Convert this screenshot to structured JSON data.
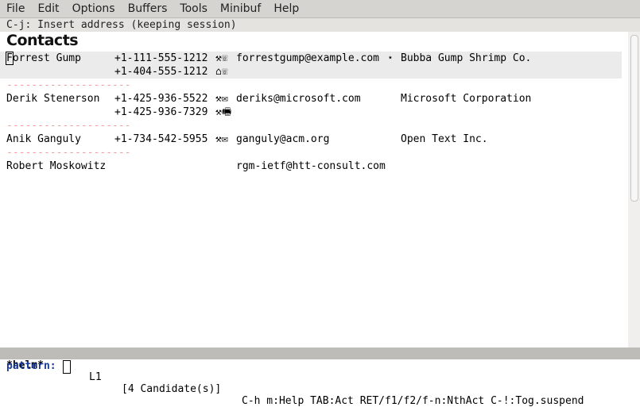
{
  "menu": [
    "File",
    "Edit",
    "Options",
    "Buffers",
    "Tools",
    "Minibuf",
    "Help"
  ],
  "helpline": "C-j: Insert address (keeping session)",
  "title": "Contacts",
  "contacts": [
    {
      "name": "Forrest Gump",
      "phones": [
        {
          "number": "+1-111-555-1212",
          "icons": "⚒☏"
        },
        {
          "number": "+1-404-555-1212",
          "icons": "⌂☏"
        }
      ],
      "email": "forrestgump@example.com",
      "star": "⋆",
      "org": "Bubba Gump Shrimp Co."
    },
    {
      "name": "Derik Stenerson",
      "phones": [
        {
          "number": "+1-425-936-5522",
          "icons": "⚒✉"
        },
        {
          "number": "+1-425-936-7329",
          "icons": "⚒🖷"
        }
      ],
      "email": "deriks@microsoft.com",
      "org": "Microsoft Corporation"
    },
    {
      "name": "Anik Ganguly",
      "phones": [
        {
          "number": "+1-734-542-5955",
          "icons": "⚒✉"
        }
      ],
      "email": "ganguly@acm.org",
      "org": "Open Text Inc."
    },
    {
      "name": "Robert Moskowitz",
      "email": "rgm-ietf@htt-consult.com"
    }
  ],
  "separator": "--------------------",
  "modeline": {
    "buffer": "*helm*",
    "line": "L1",
    "candidates": "[4 Candidate(s)]",
    "keys": "C-h m:Help TAB:Act RET/f1/f2/f-n:NthAct C-!:Tog.suspend"
  },
  "minibuffer": {
    "prompt": "pattern:"
  }
}
